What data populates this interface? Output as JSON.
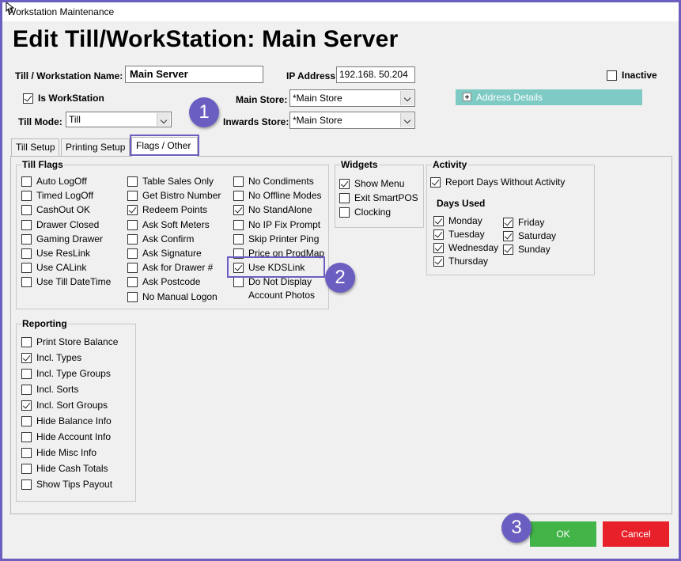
{
  "window": {
    "title": "Workstation Maintenance"
  },
  "heading": "Edit Till/WorkStation: Main Server",
  "form": {
    "name_label": "Till / Workstation Name:",
    "name_value": "Main Server",
    "ip_label": "IP Address:",
    "ip_value": "192.168.  50.204",
    "inactive_label": "Inactive",
    "inactive_checked": false,
    "is_workstation_label": "Is WorkStation",
    "is_workstation_checked": true,
    "main_store_label": "Main Store:",
    "main_store_value": "*Main Store",
    "inwards_store_label": "Inwards Store:",
    "inwards_store_value": "*Main Store",
    "till_mode_label": "Till Mode:",
    "till_mode_value": "Till",
    "address_details_label": "Address Details"
  },
  "tabs": [
    {
      "label": "Till Setup",
      "active": false
    },
    {
      "label": "Printing Setup",
      "active": false
    },
    {
      "label": "Flags / Other",
      "active": true
    }
  ],
  "till_flags": {
    "title": "Till Flags",
    "col1": [
      {
        "label": "Auto LogOff",
        "checked": false
      },
      {
        "label": "Timed LogOff",
        "checked": false
      },
      {
        "label": "CashOut OK",
        "checked": false
      },
      {
        "label": "Drawer Closed",
        "checked": false
      },
      {
        "label": "Gaming Drawer",
        "checked": false
      },
      {
        "label": "Use ResLink",
        "checked": false
      },
      {
        "label": "Use CALink",
        "checked": false
      },
      {
        "label": "Use Till DateTime",
        "checked": false
      }
    ],
    "col2": [
      {
        "label": "Table Sales Only",
        "checked": false
      },
      {
        "label": "Get Bistro Number",
        "checked": false
      },
      {
        "label": "Redeem Points",
        "checked": true
      },
      {
        "label": "Ask Soft Meters",
        "checked": false
      },
      {
        "label": "Ask Confirm",
        "checked": false
      },
      {
        "label": "Ask Signature",
        "checked": false
      },
      {
        "label": "Ask for Drawer #",
        "checked": false
      },
      {
        "label": "Ask Postcode",
        "checked": false
      },
      {
        "label": "No Manual Logon",
        "checked": false
      }
    ],
    "col3": [
      {
        "label": "No Condiments",
        "checked": false
      },
      {
        "label": "No Offline Modes",
        "checked": false
      },
      {
        "label": "No StandAlone",
        "checked": true
      },
      {
        "label": "No IP Fix Prompt",
        "checked": false
      },
      {
        "label": "Skip Printer Ping",
        "checked": false
      },
      {
        "label": "Price on ProdMap",
        "checked": false
      },
      {
        "label": "Use KDSLink",
        "checked": true
      },
      {
        "label": "Do Not Display",
        "checked": false
      }
    ],
    "col3_last_line2": "Account Photos"
  },
  "widgets": {
    "title": "Widgets",
    "items": [
      {
        "label": "Show Menu",
        "checked": true
      },
      {
        "label": "Exit SmartPOS",
        "checked": false
      },
      {
        "label": "Clocking",
        "checked": false
      }
    ]
  },
  "activity": {
    "title": "Activity",
    "report_label": "Report Days Without Activity",
    "report_checked": true,
    "days_used_label": "Days Used",
    "days_col1": [
      {
        "label": "Monday",
        "checked": true
      },
      {
        "label": "Tuesday",
        "checked": true
      },
      {
        "label": "Wednesday",
        "checked": true
      },
      {
        "label": "Thursday",
        "checked": true
      }
    ],
    "days_col2": [
      {
        "label": "Friday",
        "checked": true
      },
      {
        "label": "Saturday",
        "checked": true
      },
      {
        "label": "Sunday",
        "checked": true
      }
    ]
  },
  "reporting": {
    "title": "Reporting",
    "items": [
      {
        "label": "Print Store Balance",
        "checked": false
      },
      {
        "label": "Incl. Types",
        "checked": true
      },
      {
        "label": "Incl. Type Groups",
        "checked": false
      },
      {
        "label": "Incl. Sorts",
        "checked": false
      },
      {
        "label": "Incl. Sort Groups",
        "checked": true
      },
      {
        "label": "Hide Balance Info",
        "checked": false
      },
      {
        "label": "Hide Account Info",
        "checked": false
      },
      {
        "label": "Hide Misc Info",
        "checked": false
      },
      {
        "label": "Hide Cash Totals",
        "checked": false
      },
      {
        "label": "Show Tips Payout",
        "checked": false
      }
    ]
  },
  "buttons": {
    "ok_label": "OK",
    "cancel_label": "Cancel",
    "ok_color": "#43b548",
    "cancel_color": "#e8202a"
  },
  "badges": [
    "1",
    "2",
    "3"
  ],
  "accent_color": "#6a5fc1"
}
